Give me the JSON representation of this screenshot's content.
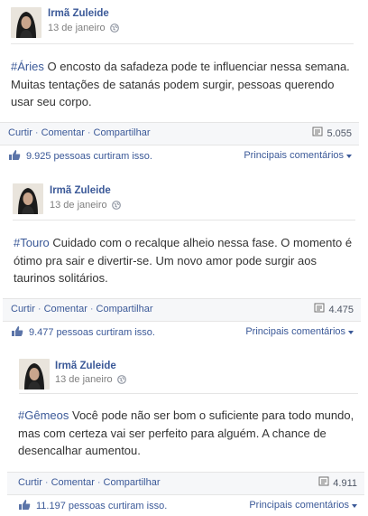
{
  "posts": [
    {
      "author": "Irmã Zuleide",
      "date": "13 de janeiro",
      "hashtag": "#Áries",
      "text_line1": " O encosto da safadeza pode te influenciar nessa semana.",
      "text_line2": "Muitas tentações de satanás podem surgir, pessoas querendo",
      "text_line3": "usar seu corpo.",
      "actions": {
        "like": "Curtir",
        "comment": "Comentar",
        "share": "Compartilhar"
      },
      "shares": "5.055",
      "likes_count": "9.925",
      "likes_text": "pessoas curtiram isso.",
      "top_comments": "Principais comentários"
    },
    {
      "author": "Irmã Zuleide",
      "date": "13 de janeiro",
      "hashtag": "#Touro",
      "text_line1": " Cuidado com o recalque alheio nessa fase. O momento é",
      "text_line2": "ótimo pra sair e divertir-se. Um novo amor pode surgir aos",
      "text_line3": "taurinos solitários.",
      "actions": {
        "like": "Curtir",
        "comment": "Comentar",
        "share": "Compartilhar"
      },
      "shares": "4.475",
      "likes_count": "9.477",
      "likes_text": "pessoas curtiram isso.",
      "top_comments": "Principais comentários"
    },
    {
      "author": "Irmã Zuleide",
      "date": "13 de janeiro",
      "hashtag": "#Gêmeos",
      "text_line1": " Você pode não ser bom o suficiente para todo mundo,",
      "text_line2": "mas com certeza vai ser perfeito para alguém. A chance de",
      "text_line3": "desencalhar aumentou.",
      "actions": {
        "like": "Curtir",
        "comment": "Comentar",
        "share": "Compartilhar"
      },
      "shares": "4.911",
      "likes_count": "11.197",
      "likes_text": "pessoas curtiram isso.",
      "top_comments": "Principais comentários"
    }
  ],
  "separator": "·",
  "colors": {
    "link": "#3b5998",
    "bar_bg": "#f6f7f9",
    "divider": "#e5e5e5"
  },
  "icons": {
    "privacy": "globe-icon",
    "shares": "share-count-icon",
    "like": "thumbs-up-icon",
    "dropdown": "caret-down-icon"
  }
}
